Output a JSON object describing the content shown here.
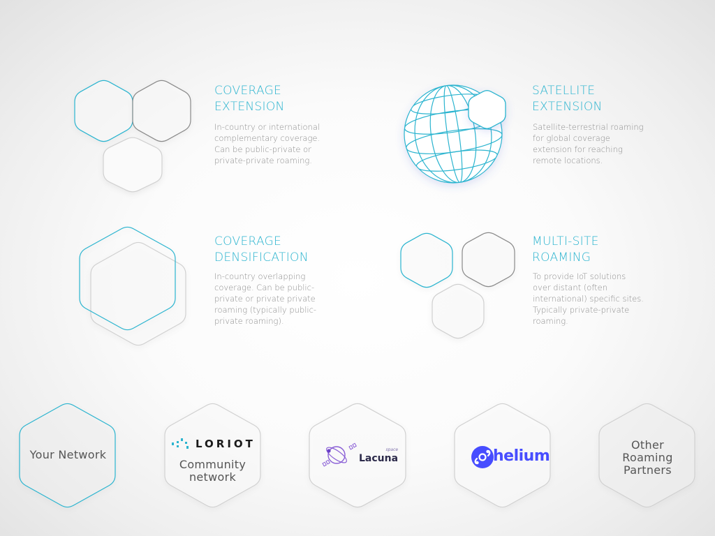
{
  "colors": {
    "accent": "#2bb4cf",
    "dark_outline": "#8a8a8a",
    "light_outline": "#d0d0d0",
    "body_text": "#8e8e8e",
    "loriot_dots": "#2bb4cf",
    "lacuna": "#8a5fd6",
    "helium": "#474dff"
  },
  "sections": {
    "coverage_extension": {
      "title_lines": [
        "COVERAGE",
        "EXTENSION"
      ],
      "desc_lines": [
        "In-country or international",
        "complementary coverage.",
        "Can be public-private or",
        "private-private roaming."
      ]
    },
    "satellite_extension": {
      "title_lines": [
        "SATELLITE",
        "EXTENSION"
      ],
      "desc_lines": [
        "Satellite-terrestrial roaming",
        "for global coverage",
        "extension for reaching",
        "remote locations."
      ]
    },
    "coverage_densification": {
      "title_lines": [
        "COVERAGE",
        "DENSIFICATION"
      ],
      "desc_lines": [
        "In-country overlapping",
        "coverage. Can be public-",
        "private or private private",
        "roaming (typically public-",
        "private roaming)."
      ]
    },
    "multi_site_roaming": {
      "title_lines": [
        "MULTI-SITE",
        "ROAMING"
      ],
      "desc_lines": [
        "To provide IoT solutions",
        "over distant (often",
        "international) specific  sites.",
        "Typically private-private",
        "roaming."
      ]
    }
  },
  "partners": {
    "your_network": {
      "label": "Your Network"
    },
    "loriot": {
      "logo_text": "LORIOT",
      "caption_lines": [
        "Community",
        "network"
      ]
    },
    "lacuna": {
      "logo_text": "Lacuna",
      "logo_sub": "space"
    },
    "helium": {
      "logo_text": "helium"
    },
    "other": {
      "label_lines": [
        "Other",
        "Roaming",
        "Partners"
      ]
    }
  }
}
